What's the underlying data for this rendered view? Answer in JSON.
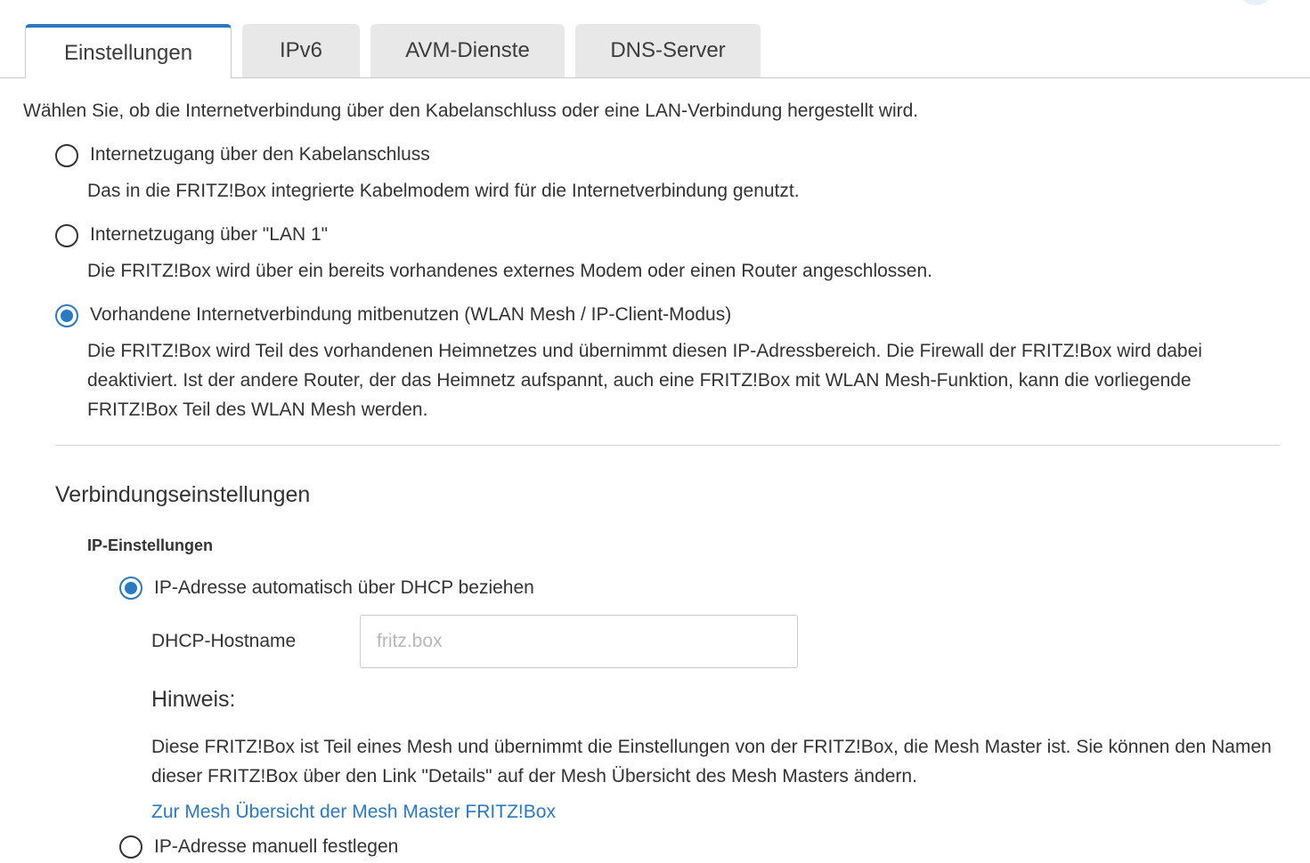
{
  "tabs": [
    {
      "label": "Einstellungen",
      "active": true
    },
    {
      "label": "IPv6",
      "active": false
    },
    {
      "label": "AVM-Dienste",
      "active": false
    },
    {
      "label": "DNS-Server",
      "active": false
    }
  ],
  "intro": "Wählen Sie, ob die Internetverbindung über den Kabelanschluss oder eine LAN-Verbindung hergestellt wird.",
  "access_options": [
    {
      "label": "Internetzugang über den Kabelanschluss",
      "description": "Das in die FRITZ!Box integrierte Kabelmodem wird für die Internetverbindung genutzt.",
      "selected": false
    },
    {
      "label": "Internetzugang über \"LAN 1\"",
      "description": "Die FRITZ!Box wird über ein bereits vorhandenes externes Modem oder einen Router angeschlossen.",
      "selected": false
    },
    {
      "label": "Vorhandene Internetverbindung mitbenutzen (WLAN Mesh / IP-Client-Modus)",
      "description": "Die FRITZ!Box wird Teil des vorhandenen Heimnetzes und übernimmt diesen IP-Adressbereich. Die Firewall der FRITZ!Box wird dabei deaktiviert. Ist der andere Router, der das Heimnetz aufspannt, auch eine FRITZ!Box mit WLAN Mesh-Funktion, kann die vorliegende FRITZ!Box Teil des WLAN Mesh werden.",
      "selected": true
    }
  ],
  "connection_settings": {
    "heading": "Verbindungseinstellungen",
    "ip_settings": {
      "heading": "IP-Einstellungen",
      "option_dhcp": {
        "label": "IP-Adresse automatisch über DHCP beziehen",
        "selected": true
      },
      "hostname": {
        "label": "DHCP-Hostname",
        "value": "",
        "placeholder": "fritz.box"
      },
      "hint": {
        "heading": "Hinweis:",
        "text": "Diese FRITZ!Box ist Teil eines Mesh und übernimmt die Einstellungen von der FRITZ!Box, die Mesh Master ist. Sie können den Namen dieser FRITZ!Box über den Link \"Details\" auf der Mesh Übersicht des Mesh Masters ändern.",
        "link": "Zur Mesh Übersicht der Mesh Master FRITZ!Box"
      },
      "option_manual": {
        "label": "IP-Adresse manuell festlegen",
        "selected": false
      }
    }
  },
  "colors": {
    "accent": "#2a7ac2",
    "text": "#333333",
    "tab_inactive": "#e8e8e8",
    "border": "#c8c8c8"
  }
}
